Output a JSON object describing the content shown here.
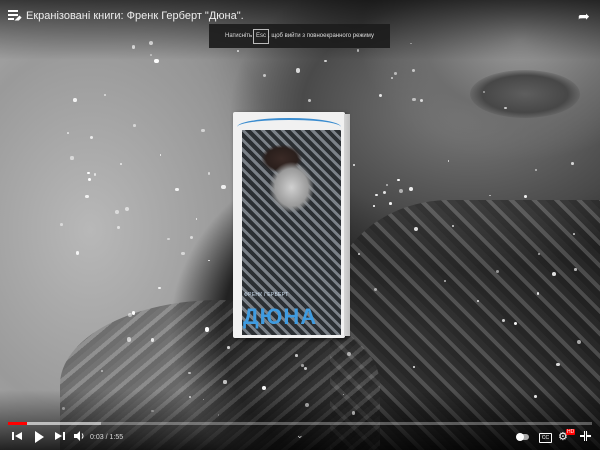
{
  "header": {
    "title": "Екранізовані книги: Френк Герберт \"Дюна\"."
  },
  "hint": {
    "before_key": "Натисніть",
    "key": "Esc",
    "after_key": ", щоб вийти з повноекранного режиму"
  },
  "book": {
    "author": "ФРЕНК ГЕРБЕРТ",
    "title": "ДЮНА"
  },
  "player": {
    "current_time": "0:03",
    "separator": "/",
    "duration": "1:55",
    "progress_fraction": 0.033,
    "buffered_fraction": 0.16,
    "hd_label": "HD",
    "cc_label": "CC",
    "accent_color": "#ff0000"
  },
  "icons": {
    "playlist": "playlist-icon",
    "share": "share-icon",
    "previous": "previous-icon",
    "play": "play-icon",
    "next": "next-icon",
    "volume": "volume-icon",
    "chapters": "chevron-down-icon",
    "autoplay": "autoplay-toggle-icon",
    "subtitles": "subtitles-icon",
    "settings": "settings-icon",
    "fullscreen": "exit-fullscreen-icon"
  }
}
